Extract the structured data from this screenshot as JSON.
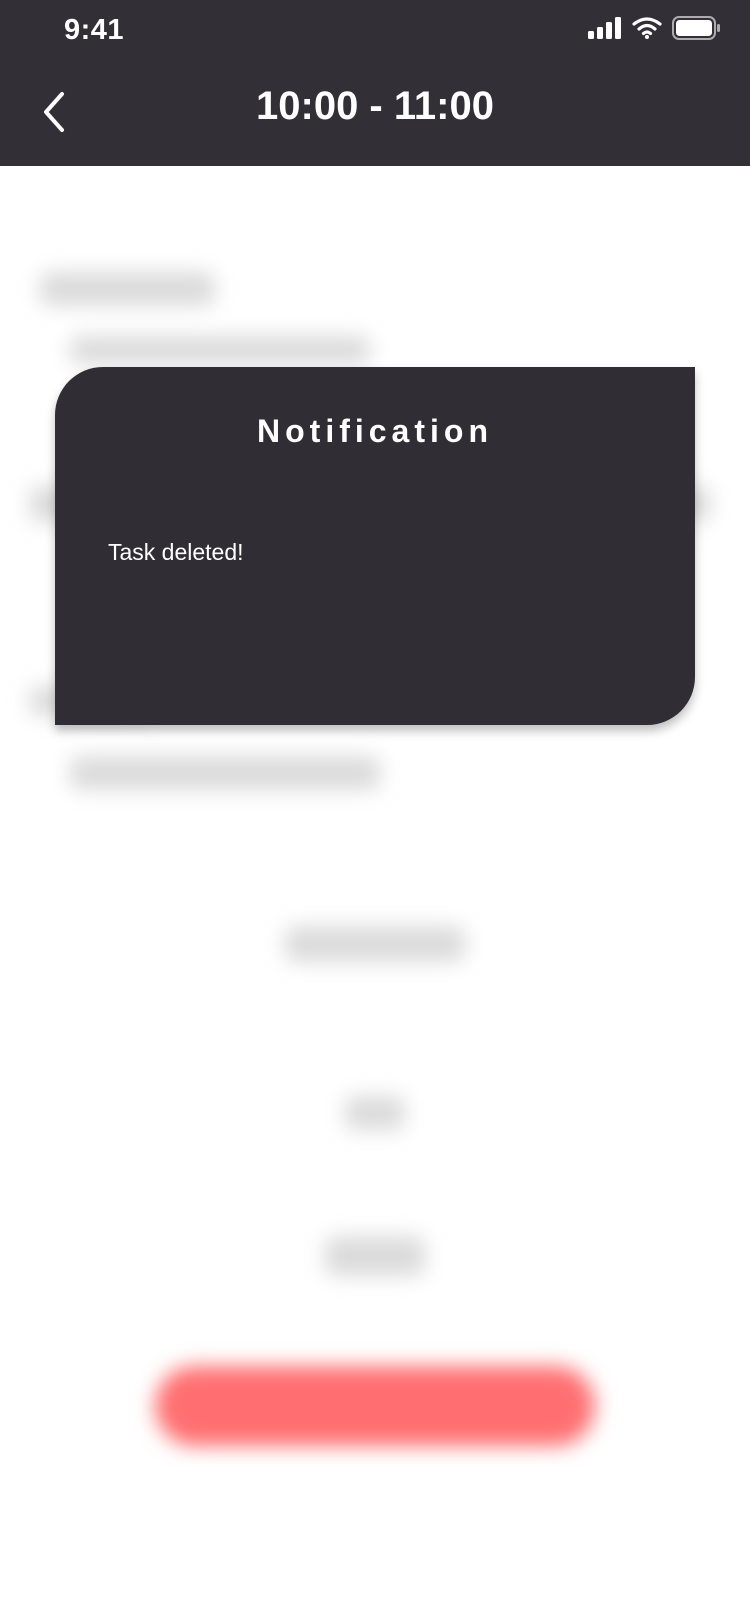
{
  "status_bar": {
    "time": "9:41",
    "icons": [
      "signal-icon",
      "wifi-icon",
      "battery-icon"
    ]
  },
  "header": {
    "title": "10:00 - 11:00",
    "back_icon": "chevron-left-icon"
  },
  "notification": {
    "title": "Notification",
    "message": "Task deleted!"
  },
  "colors": {
    "header_bg": "#322f37",
    "modal_bg": "#312d35",
    "accent_red": "#ff5f62",
    "text_light": "#ffffff"
  }
}
